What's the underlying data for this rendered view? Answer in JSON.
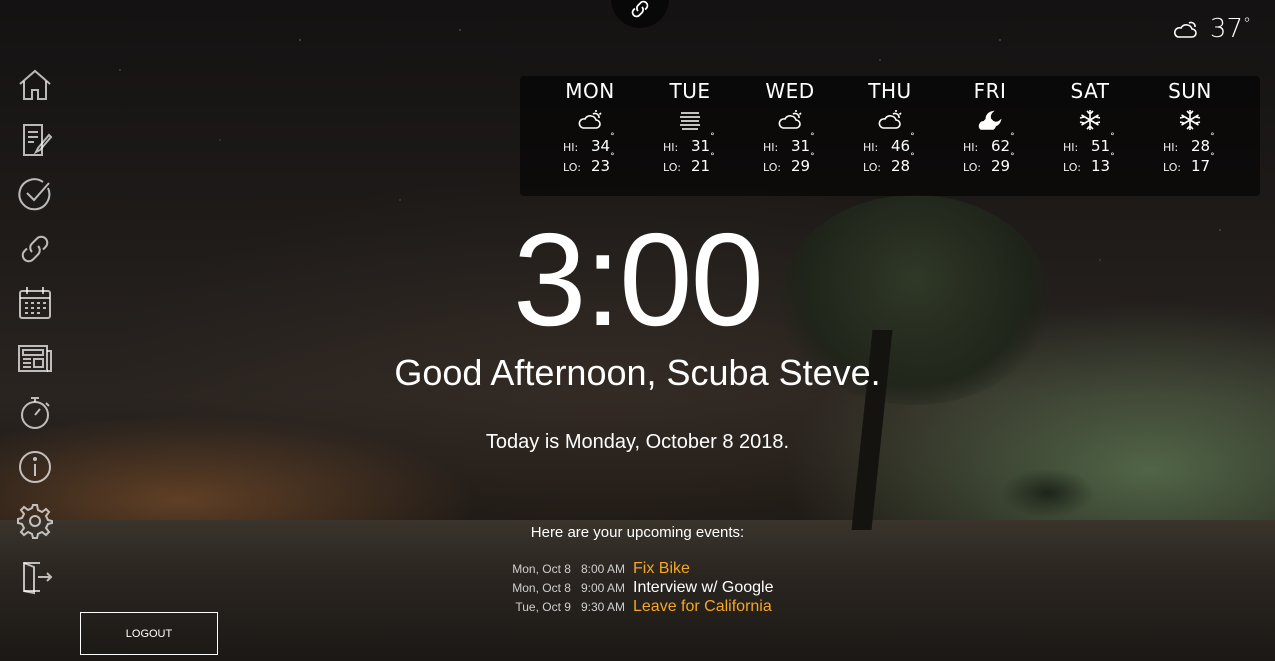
{
  "current_weather": {
    "icon": "cloudy-icon",
    "temp": "37",
    "deg": "°"
  },
  "forecast": [
    {
      "day": "MON",
      "icon": "partly-cloudy",
      "hi": "34",
      "lo": "23"
    },
    {
      "day": "TUE",
      "icon": "fog",
      "hi": "31",
      "lo": "21"
    },
    {
      "day": "WED",
      "icon": "partly-cloudy",
      "hi": "31",
      "lo": "29"
    },
    {
      "day": "THU",
      "icon": "partly-cloudy",
      "hi": "46",
      "lo": "28"
    },
    {
      "day": "FRI",
      "icon": "partly-cloudy-night",
      "hi": "62",
      "lo": "29"
    },
    {
      "day": "SAT",
      "icon": "snow",
      "hi": "51",
      "lo": "13"
    },
    {
      "day": "SUN",
      "icon": "snow",
      "hi": "28",
      "lo": "17"
    }
  ],
  "labels": {
    "hi": "HI:",
    "lo": "LO:",
    "deg": "°"
  },
  "clock": {
    "time": "3:00"
  },
  "greeting": "Good Afternoon, Scuba Steve.",
  "today": "Today is Monday, October 8 2018.",
  "events_title": "Here are your upcoming events:",
  "events": [
    {
      "date": "Mon, Oct 8",
      "time": "8:00 AM",
      "title": "Fix Bike",
      "color": "#f5a623"
    },
    {
      "date": "Mon, Oct 8",
      "time": "9:00 AM",
      "title": "Interview w/ Google",
      "color": "#ffffff"
    },
    {
      "date": "Tue, Oct 9",
      "time": "9:30 AM",
      "title": "Leave for California",
      "color": "#f5a623"
    }
  ],
  "sidebar": [
    {
      "name": "home-icon"
    },
    {
      "name": "notes-icon"
    },
    {
      "name": "checkmark-icon"
    },
    {
      "name": "link-icon"
    },
    {
      "name": "calendar-icon"
    },
    {
      "name": "news-icon"
    },
    {
      "name": "stopwatch-icon"
    },
    {
      "name": "info-icon"
    },
    {
      "name": "gear-icon"
    },
    {
      "name": "exit-icon"
    }
  ],
  "logout_label": "LOGOUT",
  "colors": {
    "accent": "#f5a623"
  }
}
